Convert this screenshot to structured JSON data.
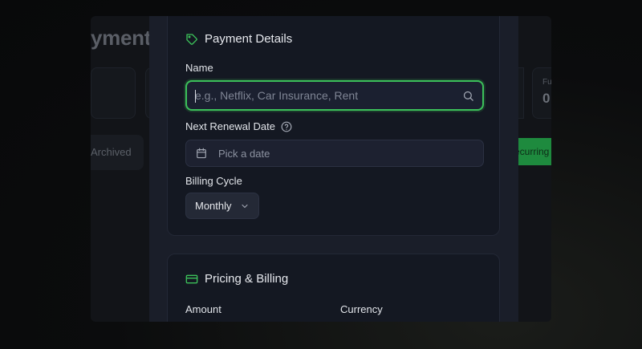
{
  "background": {
    "page_title": "yments",
    "stat_label": "Fu",
    "stat_value": "0",
    "archived_tab": "Archived",
    "recurring_button": "ecurring"
  },
  "payment_details": {
    "title": "Payment Details",
    "name_label": "Name",
    "name_value": "",
    "name_placeholder": "e.g., Netflix, Car Insurance, Rent",
    "renewal_label": "Next Renewal Date",
    "renewal_placeholder": "Pick a date",
    "billing_cycle_label": "Billing Cycle",
    "billing_cycle_value": "Monthly"
  },
  "pricing_billing": {
    "title": "Pricing & Billing",
    "amount_label": "Amount",
    "currency_label": "Currency"
  },
  "colors": {
    "accent": "#3cc05a",
    "modal_bg": "#1a1e29",
    "section_bg": "#141822"
  },
  "icons": {
    "payment_details": "tag-icon",
    "name_search": "search-icon",
    "renewal_help": "help-circle-icon",
    "date": "calendar-icon",
    "cycle": "chevron-down-icon",
    "pricing": "credit-card-icon"
  }
}
